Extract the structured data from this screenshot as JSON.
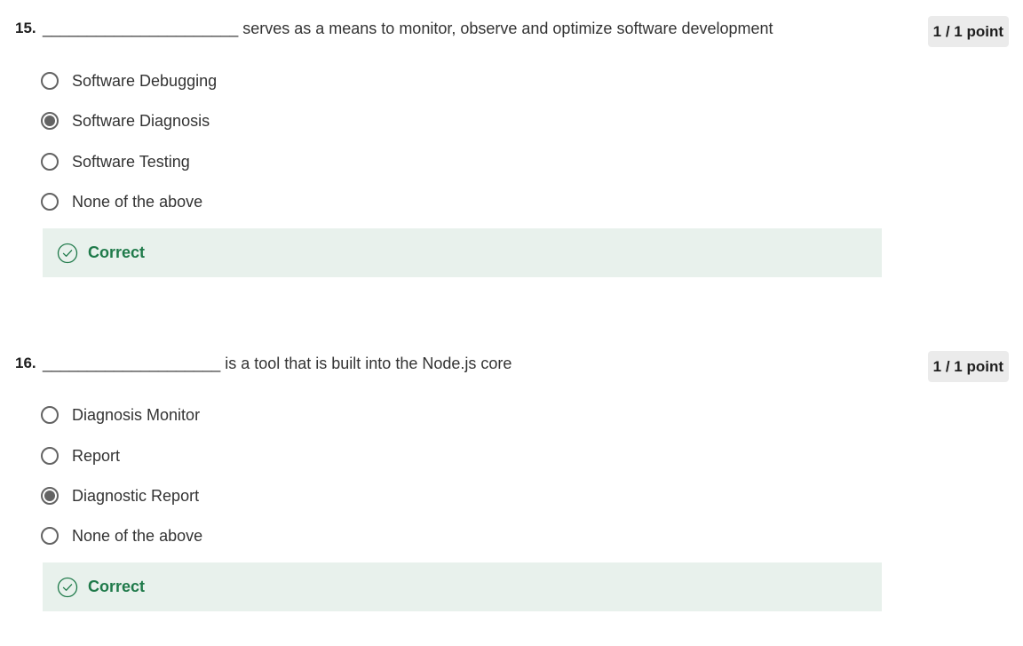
{
  "questions": [
    {
      "number": "15.",
      "text": "______________________ serves as a means to monitor, observe and optimize software development",
      "points": "1 / 1 point",
      "options": [
        {
          "label": "Software Debugging",
          "selected": false
        },
        {
          "label": "Software Diagnosis",
          "selected": true
        },
        {
          "label": "Software Testing",
          "selected": false
        },
        {
          "label": "None of the above",
          "selected": false
        }
      ],
      "feedback": {
        "label": "Correct",
        "icon": "check-circle-icon"
      }
    },
    {
      "number": "16.",
      "text": "____________________ is a tool that is built into the Node.js core",
      "points": "1 / 1 point",
      "options": [
        {
          "label": "Diagnosis Monitor",
          "selected": false
        },
        {
          "label": "Report",
          "selected": false
        },
        {
          "label": "Diagnostic Report",
          "selected": true
        },
        {
          "label": "None of the above",
          "selected": false
        }
      ],
      "feedback": {
        "label": "Correct",
        "icon": "check-circle-icon"
      }
    }
  ],
  "colors": {
    "feedback_bg": "#e8f1ec",
    "correct_green": "#1f7a4a",
    "radio_gray": "#636363",
    "badge_bg": "#ebebeb"
  }
}
